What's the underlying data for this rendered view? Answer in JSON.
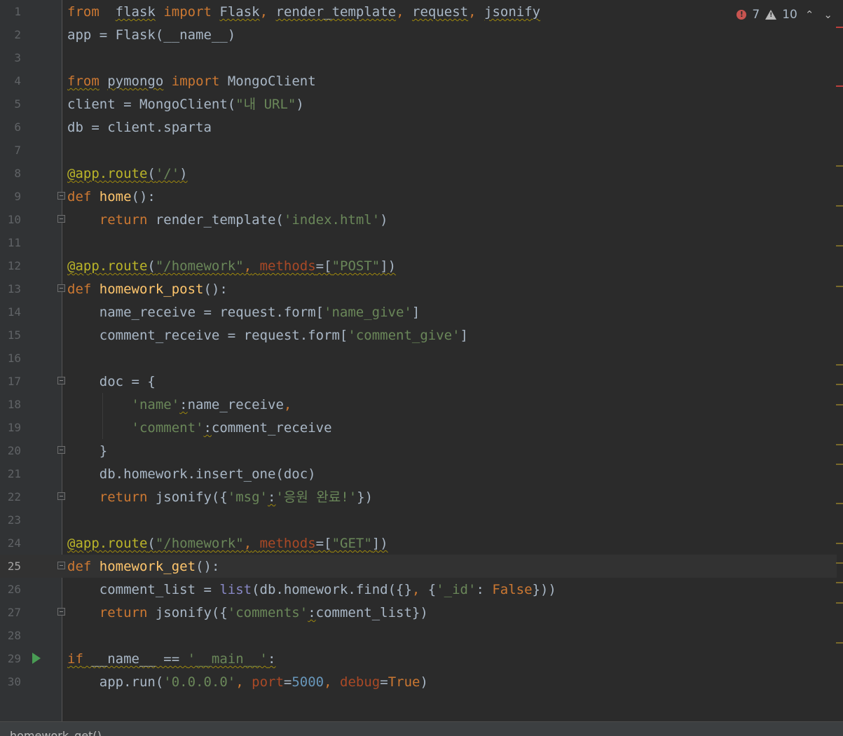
{
  "inspections": {
    "errors": "7",
    "warnings": "10",
    "up_label": "^",
    "down_label": "v"
  },
  "current_line": 25,
  "run_line": 29,
  "breadcrumb": "homework_get()",
  "lines": [
    {
      "n": "1",
      "tokens": [
        [
          "kw",
          "from"
        ],
        [
          "",
          "  "
        ],
        [
          "w",
          "flask"
        ],
        [
          "",
          " "
        ],
        [
          "kw",
          "import"
        ],
        [
          "",
          " "
        ],
        [
          "w",
          "Flask"
        ],
        [
          "kw",
          ","
        ],
        [
          "",
          " "
        ],
        [
          "w",
          "render_template"
        ],
        [
          "kw",
          ","
        ],
        [
          "",
          " "
        ],
        [
          "w",
          "request"
        ],
        [
          "kw",
          ","
        ],
        [
          "",
          " "
        ],
        [
          "w",
          "jsonify"
        ]
      ]
    },
    {
      "n": "2",
      "tokens": [
        [
          "",
          "app = Flask(__name__)"
        ]
      ]
    },
    {
      "n": "3",
      "tokens": []
    },
    {
      "n": "4",
      "tokens": [
        [
          "kww",
          "from"
        ],
        [
          "",
          " "
        ],
        [
          "w",
          "pymongo"
        ],
        [
          "",
          " "
        ],
        [
          "kw",
          "import"
        ],
        [
          "",
          " "
        ],
        [
          "",
          "MongoClient"
        ]
      ]
    },
    {
      "n": "5",
      "tokens": [
        [
          "",
          "client = MongoClient("
        ],
        [
          "str",
          "\"내 URL\""
        ],
        [
          "",
          ")"
        ]
      ]
    },
    {
      "n": "6",
      "tokens": [
        [
          "",
          "db = client.sparta"
        ]
      ]
    },
    {
      "n": "7",
      "tokens": []
    },
    {
      "n": "8",
      "tokens": [
        [
          "decw",
          "@app.route"
        ],
        [
          "w",
          "("
        ],
        [
          "strw",
          "'/'"
        ],
        [
          "w",
          ")"
        ]
      ]
    },
    {
      "n": "9",
      "tokens": [
        [
          "kw",
          "def"
        ],
        [
          "",
          " "
        ],
        [
          "fn",
          "home"
        ],
        [
          "",
          "():"
        ]
      ]
    },
    {
      "n": "10",
      "tokens": [
        [
          "",
          "    "
        ],
        [
          "kw",
          "return"
        ],
        [
          "",
          " render_template("
        ],
        [
          "str",
          "'index.html'"
        ],
        [
          "",
          ")"
        ]
      ]
    },
    {
      "n": "11",
      "tokens": []
    },
    {
      "n": "12",
      "tokens": [
        [
          "decw",
          "@app.route"
        ],
        [
          "w",
          "("
        ],
        [
          "strw",
          "\"/homework\""
        ],
        [
          "kww",
          ","
        ],
        [
          "w",
          " "
        ],
        [
          "paramw",
          "methods"
        ],
        [
          "w",
          "=["
        ],
        [
          "strw",
          "\"POST\""
        ],
        [
          "w",
          "])"
        ]
      ]
    },
    {
      "n": "13",
      "tokens": [
        [
          "kw",
          "def"
        ],
        [
          "",
          " "
        ],
        [
          "fn",
          "homework_post"
        ],
        [
          "",
          "():"
        ]
      ]
    },
    {
      "n": "14",
      "tokens": [
        [
          "",
          "    name_receive = request.form["
        ],
        [
          "str",
          "'name_give'"
        ],
        [
          "",
          "]"
        ]
      ]
    },
    {
      "n": "15",
      "tokens": [
        [
          "",
          "    comment_receive = request.form["
        ],
        [
          "str",
          "'comment_give'"
        ],
        [
          "",
          "]"
        ]
      ]
    },
    {
      "n": "16",
      "tokens": []
    },
    {
      "n": "17",
      "tokens": [
        [
          "",
          "    doc = {"
        ]
      ]
    },
    {
      "n": "18",
      "tokens": [
        [
          "",
          "        "
        ],
        [
          "str",
          "'name'"
        ],
        [
          "w",
          ":"
        ],
        [
          "",
          "name_receive"
        ],
        [
          "kw",
          ","
        ]
      ]
    },
    {
      "n": "19",
      "tokens": [
        [
          "",
          "        "
        ],
        [
          "str",
          "'comment'"
        ],
        [
          "w",
          ":"
        ],
        [
          "",
          "comment_receive"
        ]
      ]
    },
    {
      "n": "20",
      "tokens": [
        [
          "",
          "    }"
        ]
      ]
    },
    {
      "n": "21",
      "tokens": [
        [
          "",
          "    db.homework.insert_one(doc)"
        ]
      ]
    },
    {
      "n": "22",
      "tokens": [
        [
          "",
          "    "
        ],
        [
          "kw",
          "return"
        ],
        [
          "",
          " jsonify({"
        ],
        [
          "str",
          "'msg'"
        ],
        [
          "w",
          ":"
        ],
        [
          "str",
          "'응원 완료!'"
        ],
        [
          "",
          "})"
        ]
      ]
    },
    {
      "n": "23",
      "tokens": []
    },
    {
      "n": "24",
      "tokens": [
        [
          "decw",
          "@app.route"
        ],
        [
          "w",
          "("
        ],
        [
          "strw",
          "\"/homework\""
        ],
        [
          "kww",
          ","
        ],
        [
          "w",
          " "
        ],
        [
          "paramw",
          "methods"
        ],
        [
          "w",
          "=["
        ],
        [
          "strw",
          "\"GET\""
        ],
        [
          "w",
          "])"
        ]
      ]
    },
    {
      "n": "25",
      "tokens": [
        [
          "kw",
          "def"
        ],
        [
          "",
          " "
        ],
        [
          "fn",
          "homework_get"
        ],
        [
          "",
          "():"
        ]
      ]
    },
    {
      "n": "26",
      "tokens": [
        [
          "",
          "    comment_list = "
        ],
        [
          "bi",
          "list"
        ],
        [
          "",
          "(db.homework.find({}"
        ],
        [
          "kw",
          ","
        ],
        [
          "",
          " {"
        ],
        [
          "str",
          "'_id'"
        ],
        [
          "",
          ": "
        ],
        [
          "kw",
          "False"
        ],
        [
          "",
          "}))"
        ]
      ]
    },
    {
      "n": "27",
      "tokens": [
        [
          "",
          "    "
        ],
        [
          "kw",
          "return"
        ],
        [
          "",
          " jsonify({"
        ],
        [
          "str",
          "'comments'"
        ],
        [
          "w",
          ":"
        ],
        [
          "",
          "comment_list})"
        ]
      ]
    },
    {
      "n": "28",
      "tokens": []
    },
    {
      "n": "29",
      "tokens": [
        [
          "kww",
          "if"
        ],
        [
          "w",
          " __name__ == "
        ],
        [
          "strw",
          "'__main__'"
        ],
        [
          "w",
          ":"
        ]
      ]
    },
    {
      "n": "30",
      "tokens": [
        [
          "",
          "    app.run("
        ],
        [
          "str",
          "'0.0.0.0'"
        ],
        [
          "kw",
          ","
        ],
        [
          "",
          " "
        ],
        [
          "param",
          "port"
        ],
        [
          "",
          "="
        ],
        [
          "num",
          "5000"
        ],
        [
          "kw",
          ","
        ],
        [
          "",
          " "
        ],
        [
          "param",
          "debug"
        ],
        [
          "",
          "="
        ],
        [
          "kw",
          "True"
        ],
        [
          "",
          ")"
        ]
      ]
    }
  ],
  "colors": {
    "background": "#2b2b2b",
    "gutter": "#313335",
    "keyword": "#cc7832",
    "string": "#6a8759",
    "decorator": "#bbb529",
    "function": "#ffc66d",
    "number": "#6897bb",
    "error": "#c75450",
    "warning_mark": "#9e880d"
  }
}
